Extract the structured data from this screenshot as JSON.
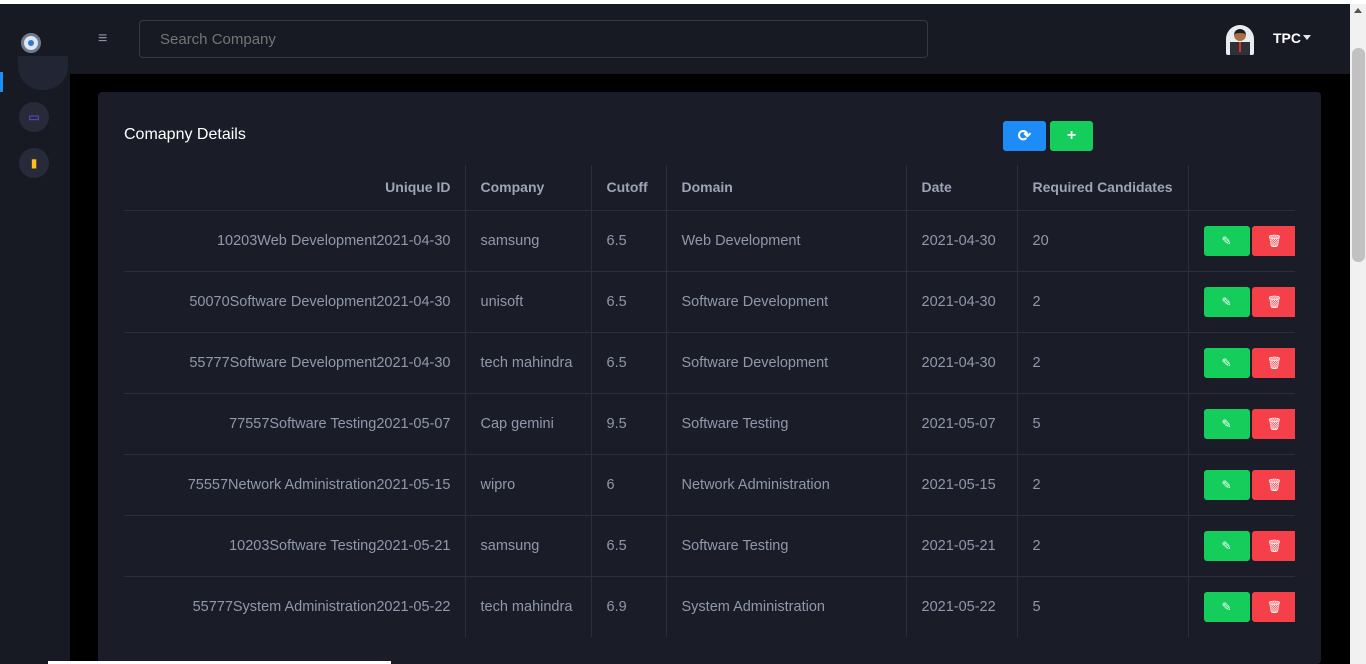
{
  "search": {
    "placeholder": "Search Company"
  },
  "user": {
    "name": "TPC"
  },
  "card": {
    "title": "Comapny Details"
  },
  "table": {
    "headers": [
      "Unique ID",
      "Company",
      "Cutoff",
      "Domain",
      "Date",
      "Required Candidates",
      ""
    ],
    "rows": [
      {
        "uid": "10203Web Development2021-04-30",
        "company": "samsung",
        "cutoff": "6.5",
        "domain": "Web Development",
        "date": "2021-04-30",
        "required": "20"
      },
      {
        "uid": "50070Software Development2021-04-30",
        "company": "unisoft",
        "cutoff": "6.5",
        "domain": "Software Development",
        "date": "2021-04-30",
        "required": "2"
      },
      {
        "uid": "55777Software Development2021-04-30",
        "company": "tech mahindra",
        "cutoff": "6.5",
        "domain": "Software Development",
        "date": "2021-04-30",
        "required": "2"
      },
      {
        "uid": "77557Software Testing2021-05-07",
        "company": "Cap gemini",
        "cutoff": "9.5",
        "domain": "Software Testing",
        "date": "2021-05-07",
        "required": "5"
      },
      {
        "uid": "75557Network Administration2021-05-15",
        "company": "wipro",
        "cutoff": "6",
        "domain": "Network Administration",
        "date": "2021-05-15",
        "required": "2"
      },
      {
        "uid": "10203Software Testing2021-05-21",
        "company": "samsung",
        "cutoff": "6.5",
        "domain": "Software Testing",
        "date": "2021-05-21",
        "required": "2"
      },
      {
        "uid": "55777System Administration2021-05-22",
        "company": "tech mahindra",
        "cutoff": "6.9",
        "domain": "System Administration",
        "date": "2021-05-22",
        "required": "5"
      }
    ]
  },
  "colors": {
    "accent": "#1e8cf7",
    "success": "#14cd5b",
    "danger": "#f5404a",
    "card": "#1a1d28"
  },
  "icons": {
    "menu": "hamburger-icon",
    "refresh": "refresh-icon",
    "add": "plus-icon",
    "edit": "edit-icon",
    "delete": "trash-icon"
  }
}
